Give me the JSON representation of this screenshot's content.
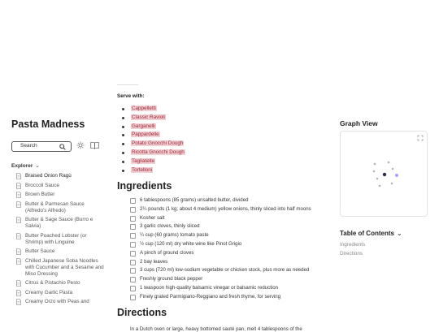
{
  "site": {
    "title": "Pasta Madness"
  },
  "search": {
    "label": "Search"
  },
  "explorer": {
    "label": "Explorer",
    "files": [
      "Braised Onion Ragù",
      "Broccoli Sauce",
      "Brown Butter",
      "Butter & Parmesan Sauce (Alfredo's Alfredo)",
      "Butter & Sage Sauce (Burro e Salvia)",
      "Butter Poached Lobster (or Shrimp) with Linguine",
      "Butter Sauce",
      "Chilled Japanese Soba Noodles with Cucumber and a Sesame and Miso Dressing",
      "Citrus & Pistachio Pesto",
      "Creamy Garlic Pasta",
      "Creamy Orzo with Peas and"
    ]
  },
  "content": {
    "serve_with_label": "Serve with:",
    "serve_with": [
      "Cappelletti",
      "Classic Ravioli",
      "Garganelli",
      "Pappardelle",
      "Potato Gnocchi Dough",
      "Ricotta Gnocchi Dough",
      "Tagliatelle",
      "Tortelloni"
    ],
    "ingredients_heading": "Ingredients",
    "ingredients": [
      "6 tablespoons (85 grams) unsalted butter, divided",
      "2¼ pounds (1 kg; about 4 medium) yellow onions, thinly sliced into half moons",
      "Kosher salt",
      "3 garlic cloves, thinly sliced",
      "¼ cup (60 grams) tomato paste",
      "½ cup (120 ml) dry white wine like Pinot Grigio",
      "A pinch of ground cloves",
      "2 bay leaves",
      "3 cups (720 ml) low-sodium vegetable or chicken stock, plus more as needed",
      "Freshly ground black pepper",
      "1 teaspoon high-quality balsamic vinegar or balsamic reduction",
      "Finely grated Parmigiano-Reggiano and fresh thyme, for serving"
    ],
    "directions_heading": "Directions",
    "directions_first_line": "In a Dutch oven or large, heavy bottomed sauté pan, melt 4 tablespoons of the"
  },
  "graph": {
    "title": "Graph View"
  },
  "toc": {
    "title": "Table of Contents",
    "items": [
      "Ingredients",
      "Directions"
    ]
  },
  "colors": {
    "link_bg": "#f2cfd2",
    "link_text": "#9b2a3c",
    "graph_node_current": "#2b2b4a",
    "graph_node_linked": "#a7a3f0",
    "graph_node": "#b5b5b5"
  }
}
